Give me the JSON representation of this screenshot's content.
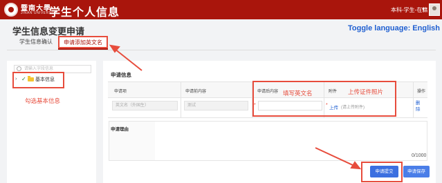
{
  "header": {
    "university_name": "暨南大學",
    "university_sub": "JINAN UNIVERSITY",
    "app_title": "学生个人信息",
    "user_role": "本科-学生-在籍",
    "caret": "▾"
  },
  "page": {
    "title": "学生信息变更申请",
    "toggle_language": "Toggle language: English",
    "tabs": [
      {
        "label": "学生信息确认"
      },
      {
        "label": "申请添加英文名"
      }
    ]
  },
  "sidebar": {
    "search_placeholder": "请输入字段信息",
    "tree": [
      {
        "caret": "›",
        "check": "✓",
        "label": "基本信息"
      }
    ],
    "annotation": "勾选基本信息"
  },
  "form": {
    "section_title": "申请信息",
    "columns": [
      "申请项",
      "申请前内容",
      "申请后内容",
      "附件",
      "操作"
    ],
    "row": {
      "item": "英文名（外国生）",
      "before": "测试",
      "after_required": "*",
      "attachment_required": "*",
      "upload_label": "上传",
      "upload_hint": "(请上传附件)",
      "delete_label": "删除"
    },
    "annotations": {
      "english_name": "填写英文名",
      "photo": "上传证件照片"
    },
    "reason_label": "申请理由",
    "counter": "0/1000",
    "buttons": {
      "submit": "申请提交",
      "save": "申请保存"
    }
  },
  "colors": {
    "brand": "#a9150c",
    "annotation": "#e74c3c",
    "link": "#1f5fd1",
    "button": "#3b6fe0"
  },
  "icons": [
    "university-logo-icon",
    "search-icon",
    "check-icon",
    "folder-icon",
    "avatar",
    "caret-down-icon"
  ]
}
